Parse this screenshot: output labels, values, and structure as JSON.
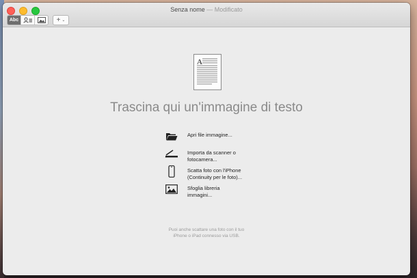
{
  "window": {
    "title": "Senza nome",
    "status": "— Modificato"
  },
  "toolbar": {
    "mode_text_label": "Abc",
    "add_label": "+"
  },
  "main": {
    "drop_title": "Trascina qui un'immagine di testo",
    "options": [
      {
        "label_line1": "Apri file immagine...",
        "label_line2": "",
        "icon": "folder-icon"
      },
      {
        "label_line1": "Importa da scanner o",
        "label_line2": "fotocamera...",
        "icon": "scanner-icon"
      },
      {
        "label_line1": "Scatta foto con l'iPhone",
        "label_line2": "(Continuity per le foto)...",
        "icon": "iphone-icon"
      },
      {
        "label_line1": "Sfoglia libreria",
        "label_line2": "immagini...",
        "icon": "photo-library-icon"
      }
    ],
    "hint_line1": "Puoi anche scattare una foto con il tuo",
    "hint_line2": "iPhone o iPad connesso via USB."
  },
  "colors": {
    "close": "#fe5f57",
    "minimize": "#febc2e",
    "maximize": "#28c840",
    "active_segment": "#6e6e6e"
  }
}
